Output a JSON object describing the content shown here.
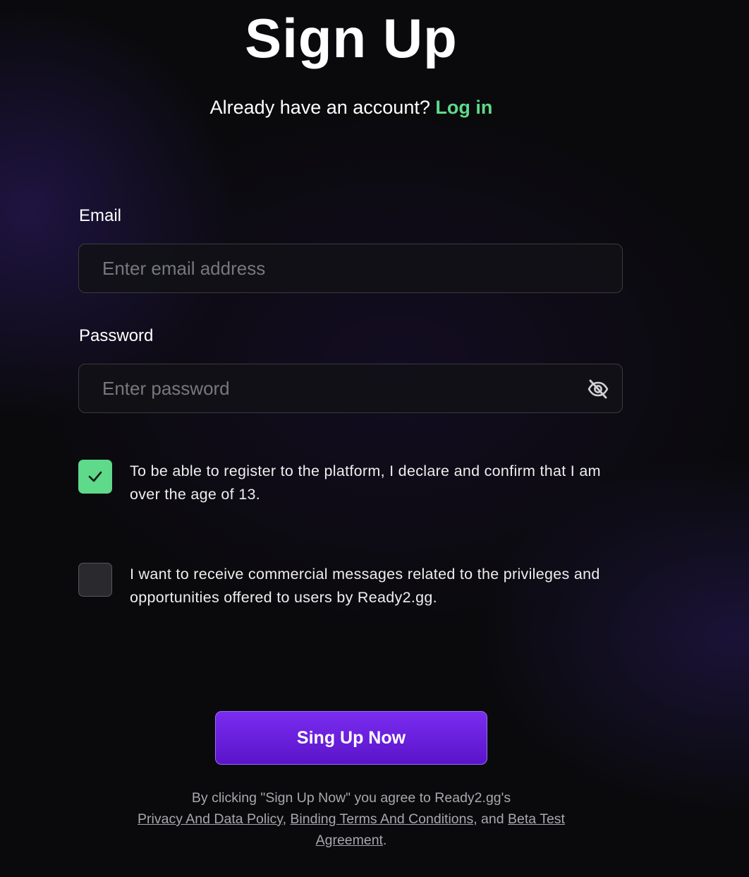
{
  "header": {
    "title": "Sign Up",
    "login_prompt": "Already have an account?",
    "login_link": "Log in"
  },
  "form": {
    "email": {
      "label": "Email",
      "placeholder": "Enter email address",
      "value": ""
    },
    "password": {
      "label": "Password",
      "placeholder": "Enter password",
      "value": "",
      "visibility_icon": "eye-slash-icon"
    },
    "age_consent": {
      "checked": true,
      "text": "To be able to register to the platform, I declare and confirm that I am over the age of 13."
    },
    "marketing_consent": {
      "checked": false,
      "text": "I want to receive commercial messages related to the privileges and opportunities offered to users by Ready2.gg."
    },
    "submit_label": "Sing Up Now"
  },
  "legal": {
    "prefix": "By clicking \"Sign Up Now\" you agree to Ready2.gg's",
    "privacy_link": "Privacy And Data Policy",
    "sep1": ",",
    "terms_link": "Binding Terms And Conditions",
    "sep2": ", and",
    "beta_link": "Beta Test Agreement",
    "suffix": "."
  },
  "colors": {
    "accent_green": "#5fd98a",
    "button_purple": "#6a1fe0",
    "background": "#0a0a0c"
  }
}
